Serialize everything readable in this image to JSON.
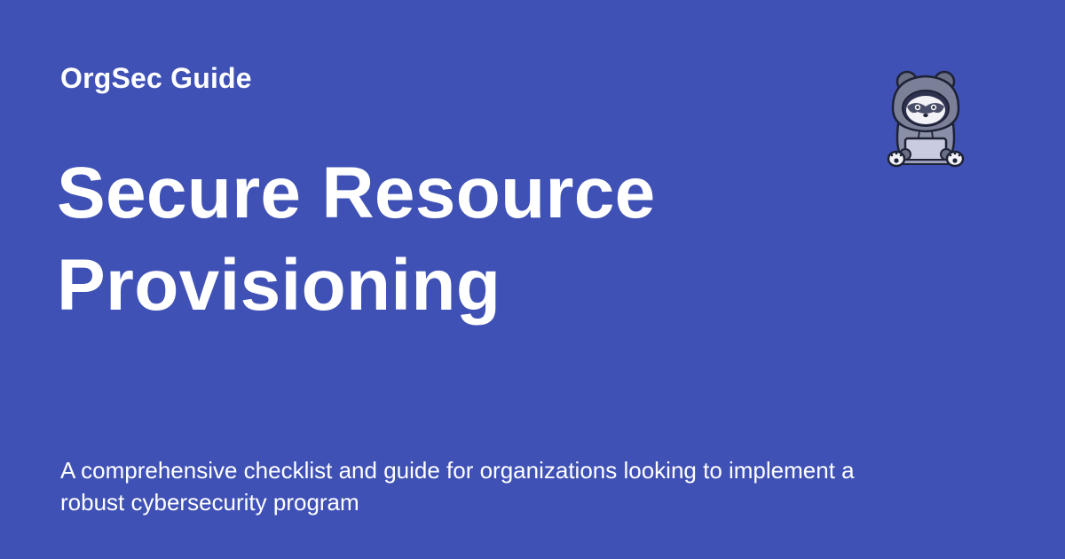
{
  "header": {
    "brand": "OrgSec Guide"
  },
  "main": {
    "title_line1": "Secure Resource",
    "title_line2": "Provisioning",
    "subtitle": "A comprehensive checklist and guide for organizations looking to implement a robust cybersecurity program"
  },
  "mascot": {
    "icon": "hooded-raccoon-laptop-icon"
  },
  "colors": {
    "background": "#3f51b5",
    "text": "#ffffff"
  }
}
